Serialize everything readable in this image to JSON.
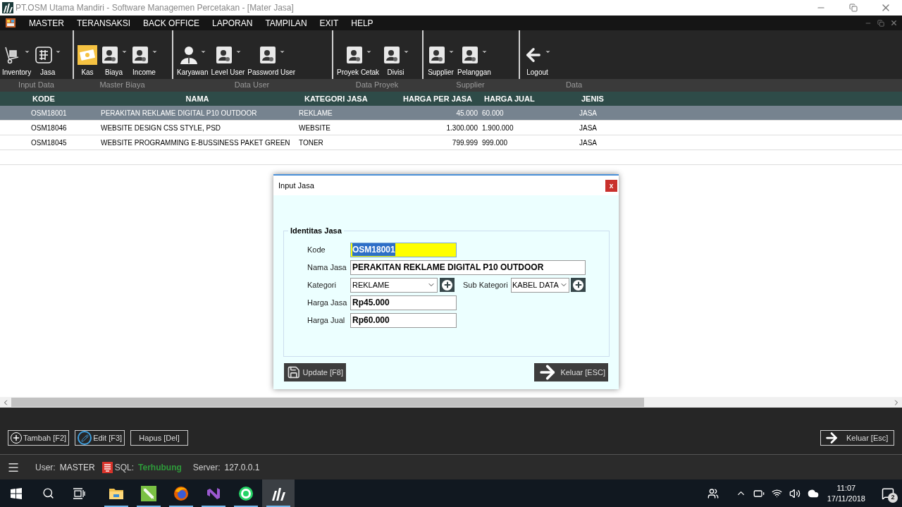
{
  "window": {
    "title": "PT.OSM Utama Mandiri - Software Managemen Percetakan - [Mater Jasa]"
  },
  "menu": [
    "MASTER",
    "TERANSAKSI",
    "BACK OFFICE",
    "LAPORAN",
    "TAMPILAN",
    "EXIT",
    "HELP"
  ],
  "toolbar": {
    "groups": [
      {
        "label": "Input Data",
        "items": [
          {
            "label": "Inventory",
            "kind": "cart",
            "selected": false,
            "dropdown": true
          },
          {
            "label": "Jasa",
            "kind": "grid",
            "selected": false,
            "dropdown": true
          }
        ]
      },
      {
        "label": "Master Biaya",
        "items": [
          {
            "label": "Kas",
            "kind": "money",
            "selected": true,
            "dropdown": false
          },
          {
            "label": "Biaya",
            "kind": "contact",
            "selected": false,
            "dropdown": true
          },
          {
            "label": "Income",
            "kind": "contact",
            "selected": false,
            "dropdown": true
          }
        ]
      },
      {
        "label": "Data User",
        "items": [
          {
            "label": "Karyawan",
            "kind": "person",
            "selected": false,
            "dropdown": true
          },
          {
            "label": "Level User",
            "kind": "contact",
            "selected": false,
            "dropdown": true
          },
          {
            "label": "Password User",
            "kind": "contact",
            "selected": false,
            "dropdown": true
          }
        ]
      },
      {
        "label": "Data Proyek",
        "items": [
          {
            "label": "Proyek Cetak",
            "kind": "contact",
            "selected": false,
            "dropdown": true
          },
          {
            "label": "Divisi",
            "kind": "contact",
            "selected": false,
            "dropdown": true
          }
        ]
      },
      {
        "label": "Supplier",
        "items": [
          {
            "label": "Supplier",
            "kind": "contact",
            "selected": false,
            "dropdown": true
          },
          {
            "label": "Pelanggan",
            "kind": "contact",
            "selected": false,
            "dropdown": true
          }
        ]
      },
      {
        "label": "Data",
        "items": [
          {
            "label": "Logout",
            "kind": "back",
            "selected": false,
            "dropdown": true
          }
        ]
      }
    ]
  },
  "table": {
    "columns": [
      "KODE",
      "NAMA",
      "KATEGORI JASA",
      "HARGA PER JASA",
      "HARGA JUAL",
      "JENIS"
    ],
    "rows": [
      {
        "selected": true,
        "cells": [
          "OSM18001",
          "PERAKITAN REKLAME DIGITAL P10 OUTDOOR",
          "REKLAME",
          "45.000",
          "60.000",
          "JASA"
        ]
      },
      {
        "selected": false,
        "cells": [
          "OSM18046",
          "WEBSITE DESIGN CSS STYLE, PSD",
          "WEBSITE",
          "1.300.000",
          "1.900.000",
          "JASA"
        ]
      },
      {
        "selected": false,
        "cells": [
          "OSM18045",
          "WEBSITE PROGRAMMING E-BUSSINESS PAKET GREEN",
          "TONER",
          "799.999",
          "999.000",
          "JASA"
        ]
      }
    ]
  },
  "dialog": {
    "title": "Input Jasa",
    "close": "x",
    "group_title": "Identitas Jasa",
    "kode": {
      "label": "Kode",
      "value": "OSM18001",
      "text_selected": true
    },
    "nama": {
      "label": "Nama Jasa",
      "value": "PERAKITAN REKLAME DIGITAL P10 OUTDOOR"
    },
    "kategori": {
      "label": "Kategori",
      "value": "REKLAME"
    },
    "sub_kategori": {
      "label": "Sub Kategori",
      "value": "KABEL DATA"
    },
    "harga_jasa": {
      "label": "Harga Jasa",
      "value": "Rp45.000"
    },
    "harga_jual": {
      "label": "Harga Jual",
      "value": "Rp60.000"
    },
    "buttons": [
      {
        "label": "Update [F8]",
        "kind": "save"
      },
      {
        "label": "Keluar [ESC]",
        "kind": "exit"
      }
    ]
  },
  "actions": [
    {
      "label": "Tambah [F2]",
      "kind": "add"
    },
    {
      "label": "Edit [F3]",
      "kind": "edit"
    },
    {
      "label": "Hapus [Del]",
      "kind": "plain"
    }
  ],
  "exit_button": {
    "label": "Keluar [Esc]"
  },
  "status": {
    "user_label": "User:",
    "user": "MASTER",
    "sql_label": "SQL:",
    "sql": "Terhubung",
    "server_label": "Server:",
    "server": "127.0.0.1"
  },
  "taskbar": {
    "apps": [
      {
        "kind": "folder",
        "running": true,
        "selected": false
      },
      {
        "kind": "corel",
        "running": true,
        "selected": false
      },
      {
        "kind": "firefox",
        "running": true,
        "selected": false
      },
      {
        "kind": "studio",
        "running": true,
        "selected": false
      },
      {
        "kind": "whatsapp",
        "running": true,
        "selected": false
      },
      {
        "kind": "app",
        "running": true,
        "selected": true
      }
    ],
    "time": "11:07",
    "date": "17/11/2018",
    "notifications": "2"
  }
}
